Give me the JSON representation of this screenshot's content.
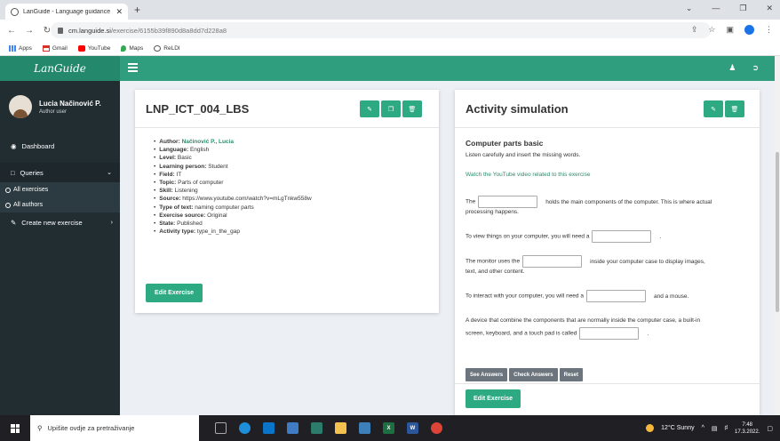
{
  "browser": {
    "tab_title": "LanGuide - Language guidance :",
    "tab_close": "✕",
    "new_tab": "+",
    "url_domain": "cm.languide.si",
    "url_path": "/exercise/6155b39f890d8a8dd7d228a8",
    "bookmarks": [
      "Apps",
      "Gmail",
      "YouTube",
      "Maps",
      "ReLDI"
    ]
  },
  "app": {
    "logo": "LanGuide",
    "accent_color": "#2e9e7f"
  },
  "sidebar": {
    "user_name": "Lucia Načinović P.",
    "user_role": "Author user",
    "dashboard": "Dashboard",
    "queries": "Queries",
    "all_exercises": "All exercises",
    "all_authors": "All authors",
    "create_new": "Create new exercise"
  },
  "exercise": {
    "title": "LNP_ICT_004_LBS",
    "details": [
      {
        "label": "Author:",
        "value": "Načinović P., Lucia"
      },
      {
        "label": "Language:",
        "value": "English"
      },
      {
        "label": "Level:",
        "value": "Basic"
      },
      {
        "label": "Learning person:",
        "value": "Student"
      },
      {
        "label": "Field:",
        "value": "IT"
      },
      {
        "label": "Topic:",
        "value": "Parts of computer"
      },
      {
        "label": "Skill:",
        "value": "Listening"
      },
      {
        "label": "Source:",
        "value": "https://www.youtube.com/watch?v=mLgTnkw558w"
      },
      {
        "label": "Type of text:",
        "value": "naming computer parts"
      },
      {
        "label": "Exercise source:",
        "value": "Original"
      },
      {
        "label": "State:",
        "value": "Published"
      },
      {
        "label": "Activity type:",
        "value": "type_in_the_gap"
      }
    ],
    "edit_button": "Edit Exercise"
  },
  "simulation": {
    "title": "Activity simulation",
    "heading": "Computer parts basic",
    "instruction": "Listen carefully and insert the missing words.",
    "youtube_link": "Watch the YouTube video related to this exercise",
    "q1_pre": "The",
    "q1_post": "holds the main components of the computer. This is where actual",
    "q1_post2": "processing happens.",
    "q2_pre": "To view things on your computer, you will need a",
    "q2_post": ".",
    "q3_pre": "The monitor uses the",
    "q3_post": "inside your computer case to display images,",
    "q3_post2": "text, and other content.",
    "q4_pre": "To interact with your computer, you will need a",
    "q4_post": "and a mouse.",
    "q5_pre": "A device that combine the components that are normally inside the computer case, a built-in",
    "q5_pre2": "screen, keyboard, and a touch pad is called",
    "q5_post": ".",
    "see_answers": "See Answers",
    "check_answers": "Check Answers",
    "reset": "Reset",
    "edit_button": "Edit Exercise"
  },
  "taskbar": {
    "search_placeholder": "Upišite ovdje za pretraživanje",
    "weather": "12°C Sunny",
    "time": "7:48",
    "date": "17.3.2022."
  }
}
